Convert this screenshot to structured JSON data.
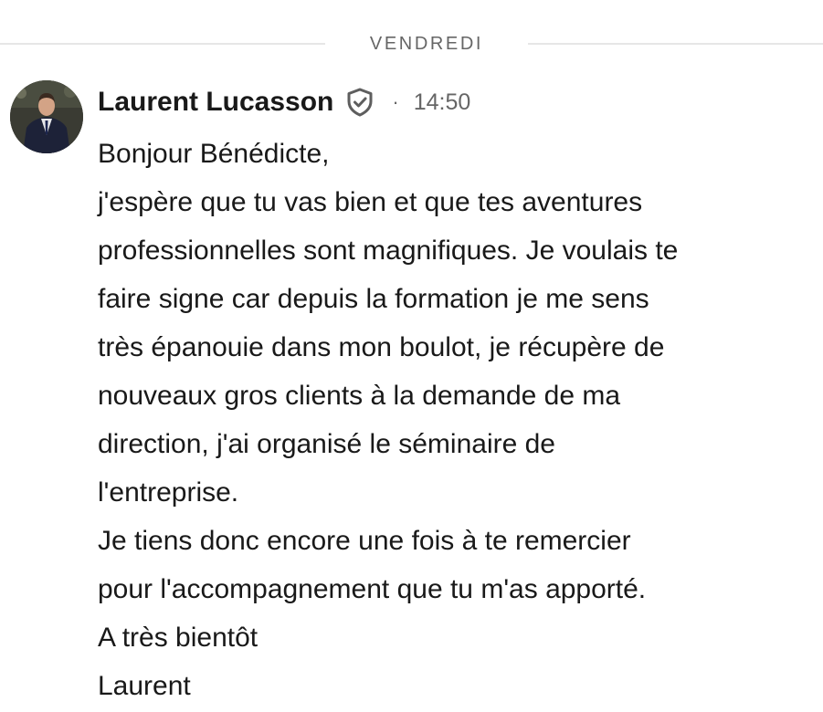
{
  "divider": {
    "label": "VENDREDI"
  },
  "message": {
    "sender": "Laurent Lucasson",
    "separator": "·",
    "time": "14:50",
    "lines": [
      "Bonjour Bénédicte,",
      "j'espère que tu vas bien et que tes aventures",
      "professionnelles sont magnifiques. Je voulais te",
      "faire signe car depuis la formation je me sens",
      "très épanouie dans mon boulot, je récupère de",
      "nouveaux gros clients à la demande de ma",
      "direction, j'ai organisé le séminaire de",
      "l'entreprise.",
      "Je tiens donc encore une fois à te remercier",
      "pour l'accompagnement que tu m'as apporté.",
      "A très bientôt",
      "Laurent"
    ]
  },
  "icons": {
    "avatar": "profile-photo",
    "verified": "shield-check-icon"
  },
  "colors": {
    "text": "#191919",
    "muted": "#666666",
    "divider_line": "#e6e6e6",
    "background": "#ffffff"
  }
}
